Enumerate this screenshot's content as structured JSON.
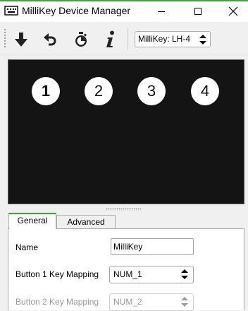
{
  "window": {
    "title": "MilliKey Device Manager"
  },
  "toolbar": {
    "device_select_value": "MilliKey: LH-4",
    "tools": [
      "download-icon",
      "undo-icon",
      "timer-icon",
      "info-icon"
    ]
  },
  "preview": {
    "keys": [
      "1",
      "2",
      "3",
      "4"
    ]
  },
  "tabs": {
    "general": "General",
    "advanced": "Advanced",
    "active": "General"
  },
  "general": {
    "name_label": "Name",
    "name_value": "MilliKey",
    "button1_label": "Button 1 Key Mapping",
    "button1_value": "NUM_1",
    "button2_label": "Button 2 Key Mapping",
    "button2_value": "NUM_2"
  },
  "colors": {
    "accent": "#3fa535",
    "preview_background": "#141414",
    "window_background": "#f0f0f0"
  }
}
